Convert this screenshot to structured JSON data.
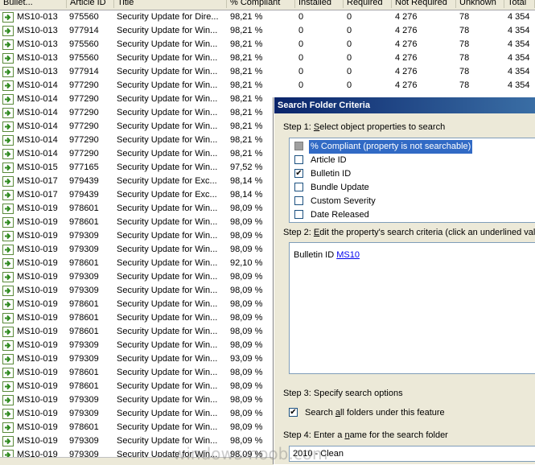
{
  "columns": {
    "bulletin": "Bullet...",
    "article": "Article ID",
    "title": "Title",
    "compliant": "% Compliant",
    "installed": "Installed",
    "required": "Required",
    "not_required": "Not Required",
    "unknown": "Unknown",
    "total": "Total"
  },
  "rows": [
    {
      "bulletin": "MS10-013",
      "article": "975560",
      "title": "Security Update for Dire...",
      "compliant": "98,21 %",
      "installed": "0",
      "required": "0",
      "not_required": "4 276",
      "unknown": "78",
      "total": "4 354"
    },
    {
      "bulletin": "MS10-013",
      "article": "977914",
      "title": "Security Update for Win...",
      "compliant": "98,21 %",
      "installed": "0",
      "required": "0",
      "not_required": "4 276",
      "unknown": "78",
      "total": "4 354"
    },
    {
      "bulletin": "MS10-013",
      "article": "975560",
      "title": "Security Update for Win...",
      "compliant": "98,21 %",
      "installed": "0",
      "required": "0",
      "not_required": "4 276",
      "unknown": "78",
      "total": "4 354"
    },
    {
      "bulletin": "MS10-013",
      "article": "975560",
      "title": "Security Update for Win...",
      "compliant": "98,21 %",
      "installed": "0",
      "required": "0",
      "not_required": "4 276",
      "unknown": "78",
      "total": "4 354"
    },
    {
      "bulletin": "MS10-013",
      "article": "977914",
      "title": "Security Update for Win...",
      "compliant": "98,21 %",
      "installed": "0",
      "required": "0",
      "not_required": "4 276",
      "unknown": "78",
      "total": "4 354"
    },
    {
      "bulletin": "MS10-014",
      "article": "977290",
      "title": "Security Update for Win...",
      "compliant": "98,21 %",
      "installed": "0",
      "required": "0",
      "not_required": "4 276",
      "unknown": "78",
      "total": "4 354"
    },
    {
      "bulletin": "MS10-014",
      "article": "977290",
      "title": "Security Update for Win...",
      "compliant": "98,21 %"
    },
    {
      "bulletin": "MS10-014",
      "article": "977290",
      "title": "Security Update for Win...",
      "compliant": "98,21 %"
    },
    {
      "bulletin": "MS10-014",
      "article": "977290",
      "title": "Security Update for Win...",
      "compliant": "98,21 %"
    },
    {
      "bulletin": "MS10-014",
      "article": "977290",
      "title": "Security Update for Win...",
      "compliant": "98,21 %"
    },
    {
      "bulletin": "MS10-014",
      "article": "977290",
      "title": "Security Update for Win...",
      "compliant": "98,21 %"
    },
    {
      "bulletin": "MS10-015",
      "article": "977165",
      "title": "Security Update for Win...",
      "compliant": "97,52 %"
    },
    {
      "bulletin": "MS10-017",
      "article": "979439",
      "title": "Security Update for Exc...",
      "compliant": "98,14 %"
    },
    {
      "bulletin": "MS10-017",
      "article": "979439",
      "title": "Security Update for Exc...",
      "compliant": "98,14 %"
    },
    {
      "bulletin": "MS10-019",
      "article": "978601",
      "title": "Security Update for Win...",
      "compliant": "98,09 %"
    },
    {
      "bulletin": "MS10-019",
      "article": "978601",
      "title": "Security Update for Win...",
      "compliant": "98,09 %"
    },
    {
      "bulletin": "MS10-019",
      "article": "979309",
      "title": "Security Update for Win...",
      "compliant": "98,09 %"
    },
    {
      "bulletin": "MS10-019",
      "article": "979309",
      "title": "Security Update for Win...",
      "compliant": "98,09 %"
    },
    {
      "bulletin": "MS10-019",
      "article": "978601",
      "title": "Security Update for Win...",
      "compliant": "92,10 %"
    },
    {
      "bulletin": "MS10-019",
      "article": "979309",
      "title": "Security Update for Win...",
      "compliant": "98,09 %"
    },
    {
      "bulletin": "MS10-019",
      "article": "979309",
      "title": "Security Update for Win...",
      "compliant": "98,09 %"
    },
    {
      "bulletin": "MS10-019",
      "article": "978601",
      "title": "Security Update for Win...",
      "compliant": "98,09 %"
    },
    {
      "bulletin": "MS10-019",
      "article": "978601",
      "title": "Security Update for Win...",
      "compliant": "98,09 %"
    },
    {
      "bulletin": "MS10-019",
      "article": "978601",
      "title": "Security Update for Win...",
      "compliant": "98,09 %"
    },
    {
      "bulletin": "MS10-019",
      "article": "979309",
      "title": "Security Update for Win...",
      "compliant": "98,09 %"
    },
    {
      "bulletin": "MS10-019",
      "article": "979309",
      "title": "Security Update for Win...",
      "compliant": "93,09 %"
    },
    {
      "bulletin": "MS10-019",
      "article": "978601",
      "title": "Security Update for Win...",
      "compliant": "98,09 %"
    },
    {
      "bulletin": "MS10-019",
      "article": "978601",
      "title": "Security Update for Win...",
      "compliant": "98,09 %"
    },
    {
      "bulletin": "MS10-019",
      "article": "979309",
      "title": "Security Update for Win...",
      "compliant": "98,09 %"
    },
    {
      "bulletin": "MS10-019",
      "article": "979309",
      "title": "Security Update for Win...",
      "compliant": "98,09 %"
    },
    {
      "bulletin": "MS10-019",
      "article": "978601",
      "title": "Security Update for Win...",
      "compliant": "98,09 %"
    },
    {
      "bulletin": "MS10-019",
      "article": "979309",
      "title": "Security Update for Win...",
      "compliant": "98,09 %"
    },
    {
      "bulletin": "MS10-019",
      "article": "979309",
      "title": "Security Update for Win...",
      "compliant": "98,09 %"
    }
  ],
  "dialog": {
    "title": "Search Folder Criteria",
    "step1_prefix": "Step 1: ",
    "step1_key": "S",
    "step1_rest": "elect object properties to search",
    "properties": [
      {
        "label": "% Compliant (property is not searchable)",
        "state": "disabled",
        "selected": true
      },
      {
        "label": "Article ID",
        "state": "unchecked"
      },
      {
        "label": "Bulletin ID",
        "state": "checked"
      },
      {
        "label": "Bundle Update",
        "state": "unchecked"
      },
      {
        "label": "Custom Severity",
        "state": "unchecked"
      },
      {
        "label": "Date Released",
        "state": "unchecked"
      }
    ],
    "check_mark": "✔",
    "step2_prefix": "Step 2: ",
    "step2_key": "E",
    "step2_rest": "dit the property's search criteria (click an underlined valu",
    "criteria_prefix": "Bulletin ID ",
    "criteria_value": "MS10",
    "step3_label": "Step 3: Specify search options",
    "search_all_prefix": "Search ",
    "search_all_key": "a",
    "search_all_rest": "ll folders under this feature",
    "step4_prefix": "Step 4: Enter a ",
    "step4_key": "n",
    "step4_rest": "ame for the search folder",
    "folder_name": "2010 - Clean"
  },
  "watermark": "windows-noob.com"
}
